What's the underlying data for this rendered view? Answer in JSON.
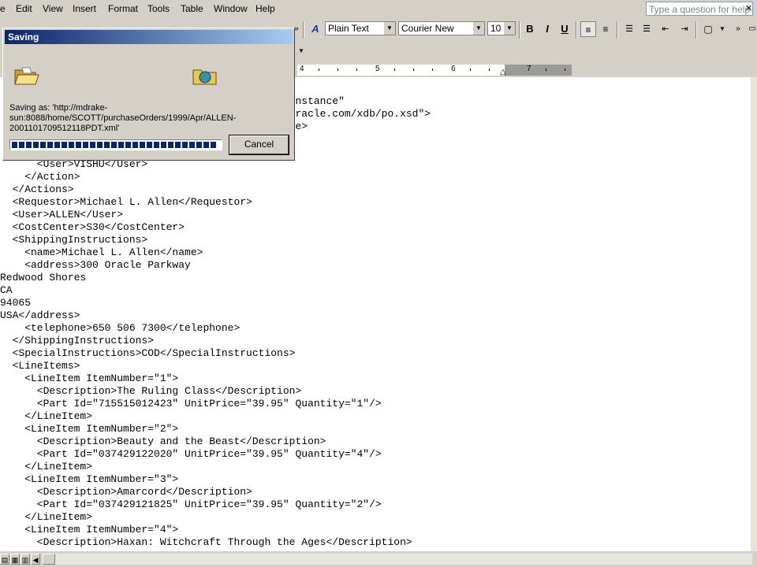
{
  "menu": {
    "items": [
      "e",
      "Edit",
      "View",
      "Insert",
      "Format",
      "Tools",
      "Table",
      "Window",
      "Help"
    ],
    "help_placeholder": "Type a question for help"
  },
  "toolbar": {
    "style": "Plain Text",
    "font": "Courier New",
    "size": "10",
    "bold": "B",
    "italic": "I",
    "underline": "U"
  },
  "ruler": {
    "numbers": [
      "4",
      "5",
      "6",
      "7"
    ]
  },
  "dialog": {
    "title": "Saving",
    "saving_as": "Saving as: 'http://mdrake-sun:8088/home/SCOTT/purchaseOrders/1999/Apr/ALLEN-2001101709512118PDT.xml'",
    "cancel_label": "Cancel",
    "progress_percent": 100
  },
  "document": {
    "lines": [
      "                                               instance\"",
      "                                               oracle.com/xdb/po.xsd\">",
      "                                               ce>",
      "",
      "",
      "      <User>VISHU</User>",
      "    </Action>",
      "  </Actions>",
      "  <Requestor>Michael L. Allen</Requestor>",
      "  <User>ALLEN</User>",
      "  <CostCenter>S30</CostCenter>",
      "  <ShippingInstructions>",
      "    <name>Michael L. Allen</name>",
      "    <address>300 Oracle Parkway",
      "Redwood Shores",
      "CA",
      "94065",
      "USA</address>",
      "    <telephone>650 506 7300</telephone>",
      "  </ShippingInstructions>",
      "  <SpecialInstructions>COD</SpecialInstructions>",
      "  <LineItems>",
      "    <LineItem ItemNumber=\"1\">",
      "      <Description>The Ruling Class</Description>",
      "      <Part Id=\"715515012423\" UnitPrice=\"39.95\" Quantity=\"1\"/>",
      "    </LineItem>",
      "    <LineItem ItemNumber=\"2\">",
      "      <Description>Beauty and the Beast</Description>",
      "      <Part Id=\"037429122020\" UnitPrice=\"39.95\" Quantity=\"4\"/>",
      "    </LineItem>",
      "    <LineItem ItemNumber=\"3\">",
      "      <Description>Amarcord</Description>",
      "      <Part Id=\"037429121825\" UnitPrice=\"39.95\" Quantity=\"2\"/>",
      "    </LineItem>",
      "    <LineItem ItemNumber=\"4\">",
      "      <Description>Haxan: Witchcraft Through the Ages</Description>"
    ]
  }
}
